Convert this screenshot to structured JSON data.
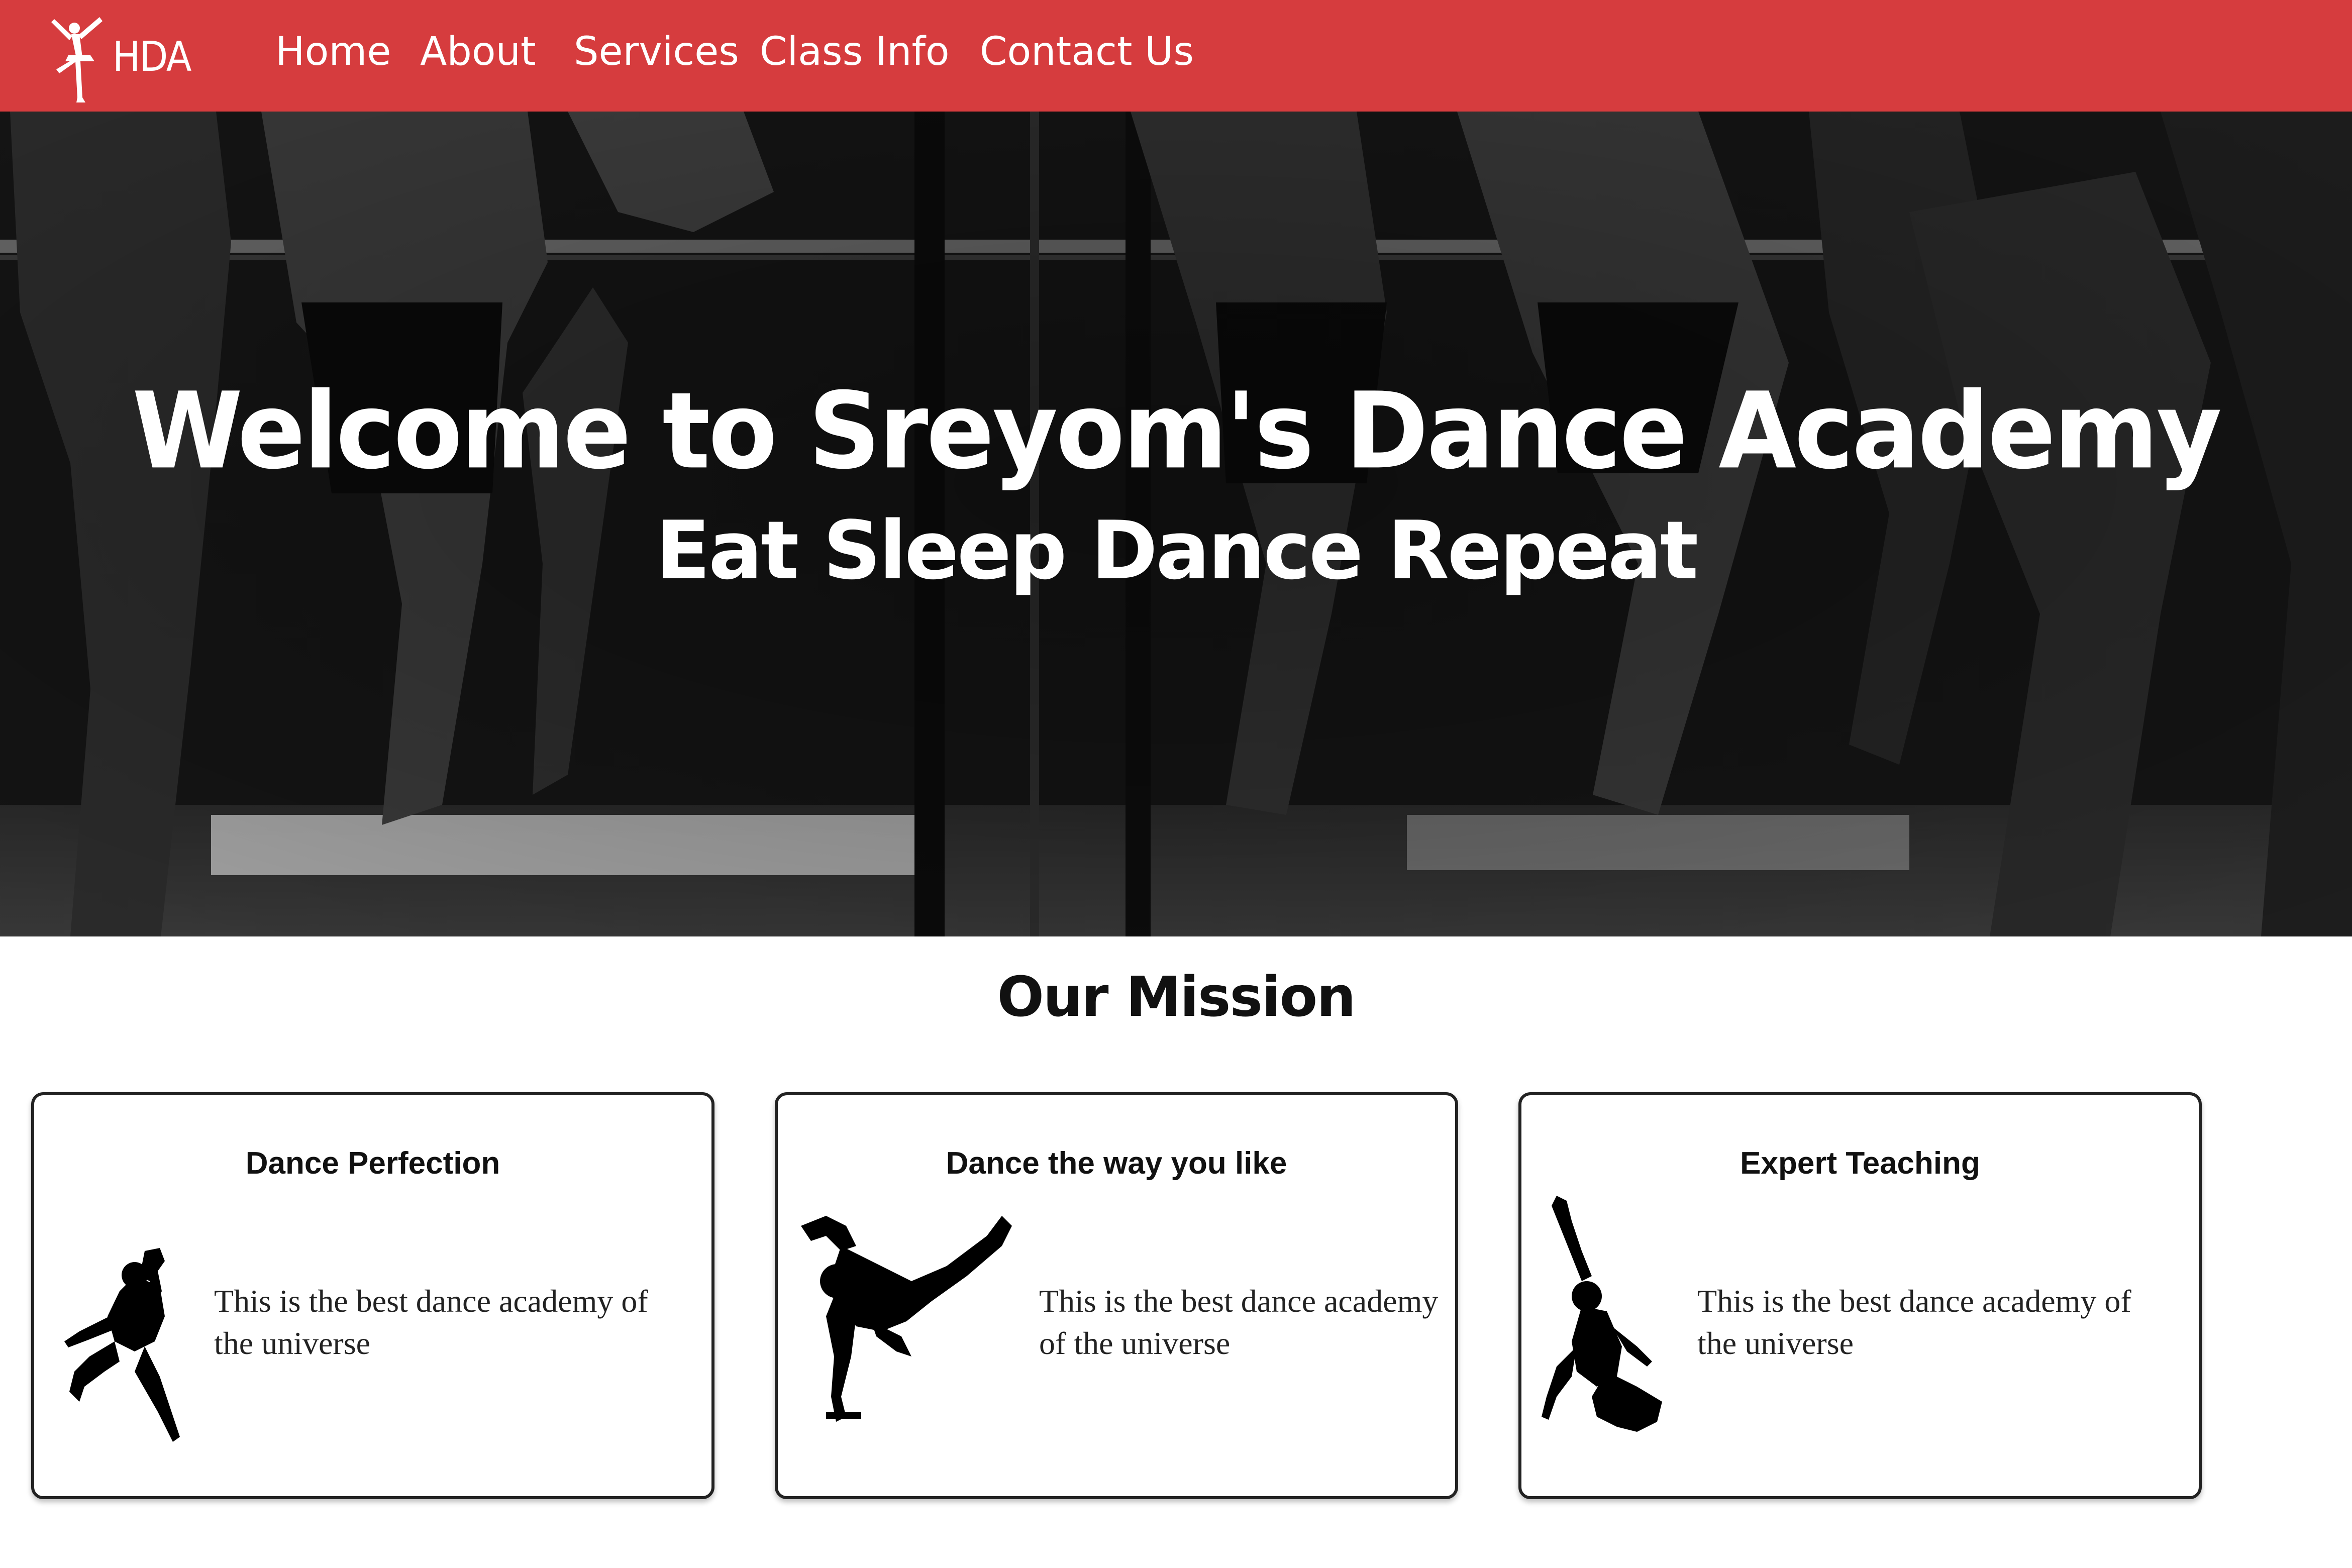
{
  "navbar": {
    "logo_text": "HDA",
    "links": [
      "Home",
      "About",
      "Services",
      "Class Info",
      "Contact Us"
    ]
  },
  "hero": {
    "title": "Welcome to Sreyom's Dance Academy",
    "subtitle": "Eat Sleep Dance Repeat"
  },
  "mission": {
    "heading": "Our Mission",
    "cards": [
      {
        "title": "Dance Perfection",
        "text": "This is the best dance academy of the universe",
        "icon": "dancer-silhouette-icon"
      },
      {
        "title": "Dance the way you like",
        "text": "This is the best dance academy of the universe",
        "icon": "breakdancer-silhouette-icon"
      },
      {
        "title": "Expert Teaching",
        "text": "This is the best dance academy of the universe",
        "icon": "dancer-reaching-silhouette-icon"
      }
    ]
  },
  "colors": {
    "navbar": "#d63c3e",
    "hero_background": "#121212",
    "text_light": "#ffffff",
    "text_dark": "#111111"
  }
}
